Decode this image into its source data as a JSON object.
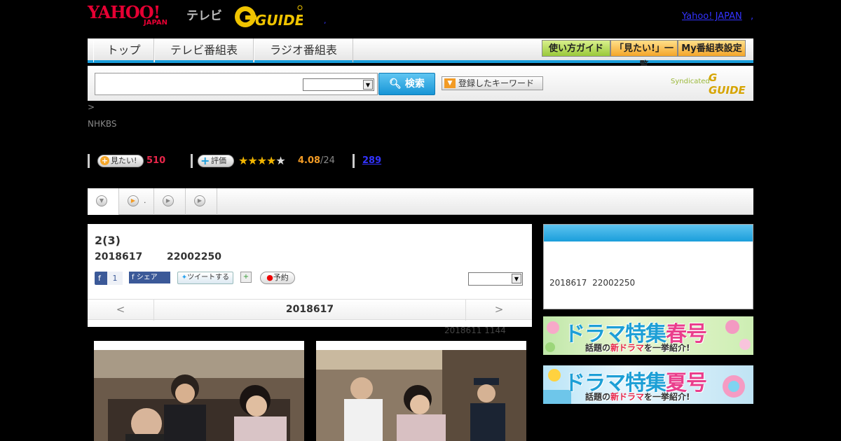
{
  "header": {
    "logo_yahoo": "YAHOO!",
    "logo_japan": "JAPAN",
    "logo_tv": "テレビ",
    "logo_gguide": "G GUIDE",
    "link_yahoo": "Yahoo! JAPAN",
    "link_dot": ",",
    "tiny_dot": ","
  },
  "nav": {
    "tabs": [
      "トップ",
      "テレビ番組表",
      "ラジオ番組表"
    ],
    "buttons": [
      "使い方ガイド",
      "「見たい!」一覧",
      "My番組表設定"
    ]
  },
  "search": {
    "input_value": "",
    "select_value": "",
    "button_label": "検索",
    "keyword_button": "登録したキーワード",
    "syndicated": "Syndicated",
    "syn_logo": "G GUIDE"
  },
  "breadcrumb": ">",
  "channel": "NHKBS",
  "stats": {
    "want_label": "見たい!",
    "want_count": "510",
    "rate_label": "評価",
    "rating": 4.08,
    "rating_text": "4.08",
    "rating_count": "/24",
    "review_count": "289",
    "stars": "★★★★",
    "star_empty": "★"
  },
  "tabs": {
    "tab2_label": "."
  },
  "program": {
    "title": "2(3)",
    "date": "2018617",
    "time": "22002250",
    "fb_like": "f",
    "fb_count": "1",
    "fb_share": "f シェア",
    "tweet": "ツイートする",
    "record": "予約",
    "record_dot": "●",
    "day_prev": "<",
    "day_date": "2018617",
    "day_next": ">"
  },
  "update_info": "2018611  1144",
  "sidebar": {
    "info_date": "2018617",
    "info_time": "22002250",
    "banner1_title_a": "ドラマ特集",
    "banner1_title_b": "春号",
    "banner1_sub_a": "話題の",
    "banner1_sub_b": "新ドラマ",
    "banner1_sub_c": "を一挙紹介!",
    "banner2_title_a": "ドラマ特集",
    "banner2_title_b": "夏号",
    "banner2_sub_a": "話題の",
    "banner2_sub_b": "新ドラマ",
    "banner2_sub_c": "を一挙紹介!"
  },
  "colors": {
    "accent_blue": "#1a9edb",
    "yahoo_red": "#e60033",
    "want_pink": "#e8264a",
    "rating_orange": "#f29b25"
  }
}
